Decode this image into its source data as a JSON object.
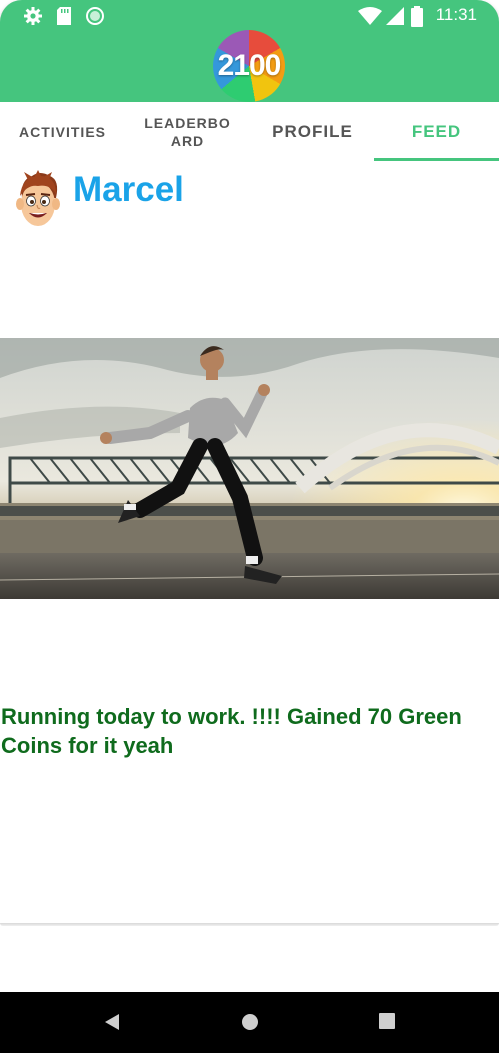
{
  "status_bar": {
    "time": "11:31",
    "left_icons": [
      "gear-icon",
      "sd-card-icon",
      "circle-icon"
    ],
    "right_icons": [
      "wifi-icon",
      "signal-icon",
      "battery-icon"
    ]
  },
  "app": {
    "logo_text": "2100",
    "accent_color": "#45c57e"
  },
  "tabs": [
    {
      "label": "ACTIVITIES",
      "active": false
    },
    {
      "label": "LEADERBOARD",
      "active": false
    },
    {
      "label": "PROFILE",
      "active": false
    },
    {
      "label": "FEED",
      "active": true
    }
  ],
  "post": {
    "username": "Marcel",
    "caption": "Running today to work. !!!! Gained 70 Green Coins for it yeah",
    "username_color": "#1aa3e8",
    "caption_color": "#0f6b1d"
  },
  "navigation_bar": {
    "buttons": [
      "back-icon",
      "home-icon",
      "recents-icon"
    ]
  }
}
